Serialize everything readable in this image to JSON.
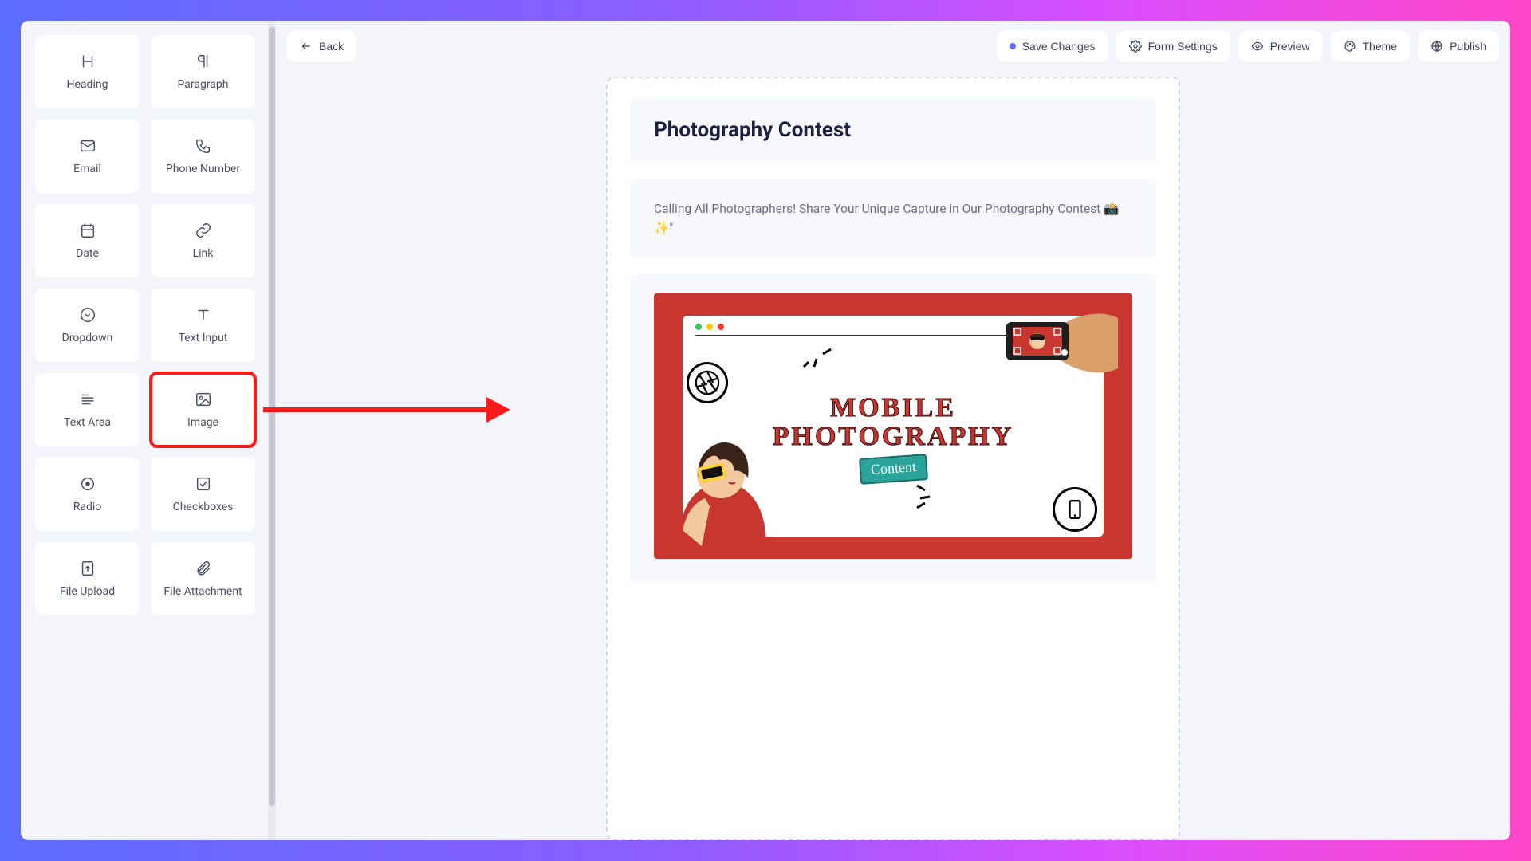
{
  "topbar": {
    "back": "Back",
    "save": "Save Changes",
    "settings": "Form Settings",
    "preview": "Preview",
    "theme": "Theme",
    "publish": "Publish"
  },
  "sidebar": {
    "fields": [
      {
        "id": "heading",
        "label": "Heading",
        "icon": "heading"
      },
      {
        "id": "paragraph",
        "label": "Paragraph",
        "icon": "paragraph"
      },
      {
        "id": "email",
        "label": "Email",
        "icon": "mail"
      },
      {
        "id": "phone",
        "label": "Phone Number",
        "icon": "phone"
      },
      {
        "id": "date",
        "label": "Date",
        "icon": "calendar"
      },
      {
        "id": "link",
        "label": "Link",
        "icon": "link"
      },
      {
        "id": "dropdown",
        "label": "Dropdown",
        "icon": "dropdown"
      },
      {
        "id": "text-input",
        "label": "Text Input",
        "icon": "text"
      },
      {
        "id": "text-area",
        "label": "Text Area",
        "icon": "textarea"
      },
      {
        "id": "image",
        "label": "Image",
        "icon": "image",
        "highlight": true
      },
      {
        "id": "radio",
        "label": "Radio",
        "icon": "radio"
      },
      {
        "id": "checkboxes",
        "label": "Checkboxes",
        "icon": "check"
      },
      {
        "id": "file-upload",
        "label": "File Upload",
        "icon": "upload"
      },
      {
        "id": "file-attachment",
        "label": "File Attachment",
        "icon": "clip"
      }
    ]
  },
  "form": {
    "title": "Photography Contest",
    "description": "Calling All Photographers! Share Your Unique Capture in Our Photography Contest 📸✨\"",
    "poster": {
      "line1": "MOBILE",
      "line2": "PHOTOGRAPHY",
      "badge": "Content"
    }
  }
}
